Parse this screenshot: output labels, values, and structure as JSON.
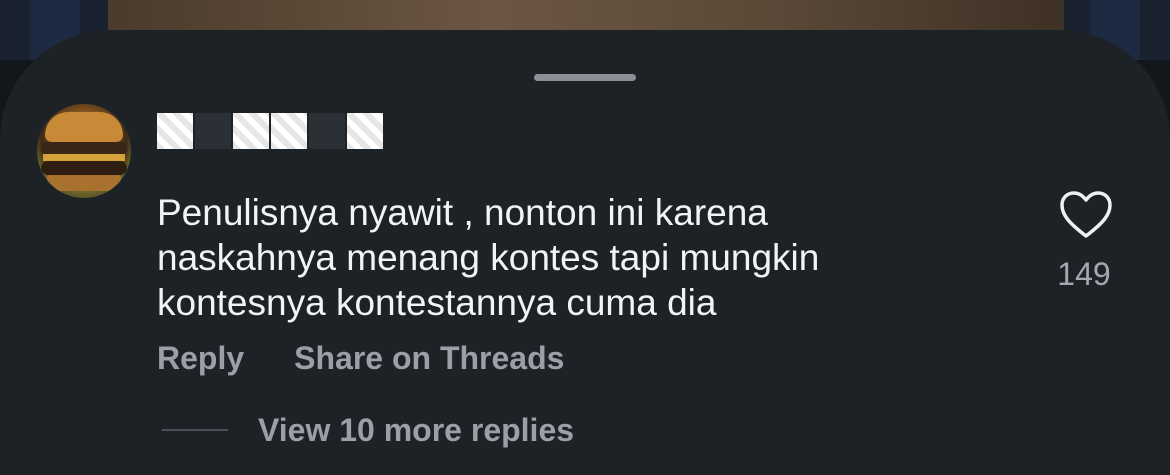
{
  "comment": {
    "username": "",
    "text": "Penulisnya nyawit , nonton ini karena\nnaskahnya menang kontes tapi mungkin\nkontesnya kontestannya cuma dia",
    "likes": "149"
  },
  "actions": {
    "reply": "Reply",
    "share": "Share on Threads"
  },
  "replies": {
    "view_more": "View 10 more replies"
  },
  "icons": {
    "like": "heart-icon",
    "avatar": "avatar-image"
  },
  "colors": {
    "sheet_background": "#1d2227",
    "primary_text": "#f2f3f5",
    "secondary_text": "#9aa0a6"
  }
}
